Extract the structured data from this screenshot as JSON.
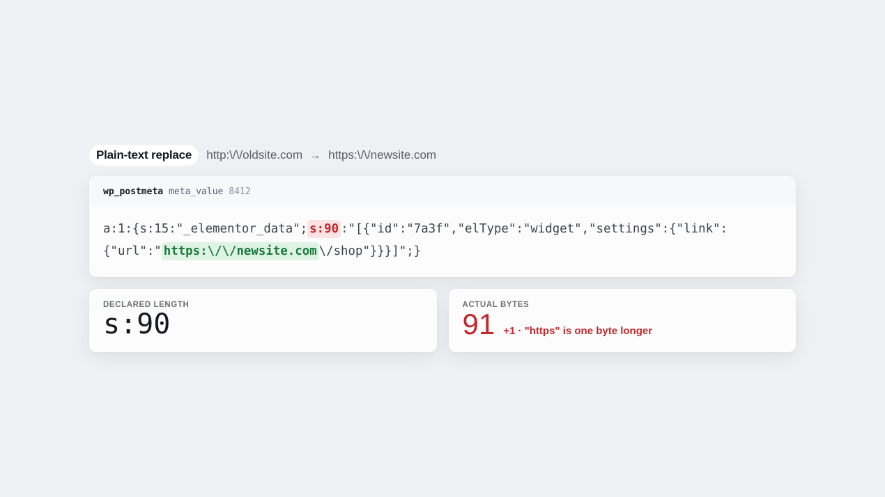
{
  "header": {
    "mode_label": "Plain-text replace",
    "from_url": "http:\\/\\/oldsite.com",
    "arrow": "→",
    "to_url": "https:\\/\\/newsite.com"
  },
  "record": {
    "table": "wp_postmeta",
    "column": "meta_value",
    "row_id": "8412"
  },
  "serialized": {
    "line1_prefix": "a:1:{s:15:\"_elementor_data\";",
    "line1_length": "s:90",
    "line1_suffix": ":\"[{\"id\":\"7a3f\",\"elType\":\"widget\",\"settings\":{\"link\":",
    "line2_prefix": "{\"url\":\"",
    "line2_url": "https:\\/\\/newsite.com",
    "line2_suffix": "\\/shop\"}}}]\";}"
  },
  "declared": {
    "label": "Declared length",
    "value": "s:90"
  },
  "actual": {
    "label": "Actual bytes",
    "value": "91",
    "note": "+1 · \"https\" is one byte longer"
  },
  "colors": {
    "error": "#c0282b",
    "success": "#1b7a3d",
    "background": "#eef0f3"
  }
}
